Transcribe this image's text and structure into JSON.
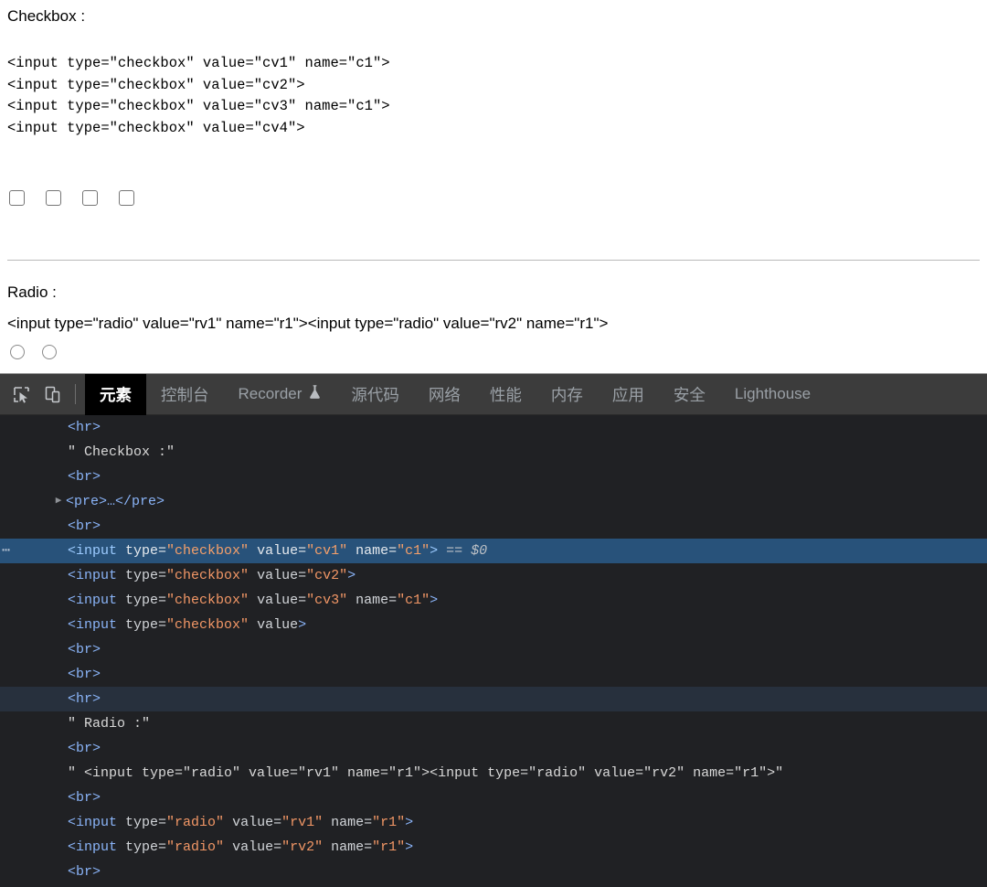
{
  "page": {
    "checkbox_heading": "Checkbox :",
    "checkbox_code": "<input type=\"checkbox\" value=\"cv1\" name=\"c1\">\n<input type=\"checkbox\" value=\"cv2\">\n<input type=\"checkbox\" value=\"cv3\" name=\"c1\">\n<input type=\"checkbox\" value=\"cv4\">",
    "checkboxes": [
      {
        "name": "checkbox-cv1",
        "checked": false
      },
      {
        "name": "checkbox-cv2",
        "checked": false
      },
      {
        "name": "checkbox-cv3",
        "checked": false
      },
      {
        "name": "checkbox-cv4",
        "checked": false
      }
    ],
    "radio_heading": "Radio :",
    "radio_code": "<input type=\"radio\" value=\"rv1\" name=\"r1\"><input type=\"radio\" value=\"rv2\" name=\"r1\">",
    "radios": [
      {
        "name": "radio-rv1",
        "checked": false
      },
      {
        "name": "radio-rv2",
        "checked": false
      }
    ]
  },
  "devtools": {
    "toolbar": {
      "inspect_icon": "inspect-element-cursor-icon",
      "device_icon": "device-toolbar-icon",
      "tabs": [
        {
          "label": "元素",
          "selected": true,
          "icon": null
        },
        {
          "label": "控制台",
          "selected": false,
          "icon": null
        },
        {
          "label": "Recorder",
          "selected": false,
          "icon": "flask-experimental-icon"
        },
        {
          "label": "源代码",
          "selected": false,
          "icon": null
        },
        {
          "label": "网络",
          "selected": false,
          "icon": null
        },
        {
          "label": "性能",
          "selected": false,
          "icon": null
        },
        {
          "label": "内存",
          "selected": false,
          "icon": null
        },
        {
          "label": "应用",
          "selected": false,
          "icon": null
        },
        {
          "label": "安全",
          "selected": false,
          "icon": null
        },
        {
          "label": "Lighthouse",
          "selected": false,
          "icon": null
        }
      ]
    },
    "colors": {
      "panel_background": "#202124",
      "toolbar_background": "#3c3c3c",
      "selected_row": "#28527a",
      "hovered_row": "#27303d",
      "tag_color": "#8ab4f8",
      "attr_value_color": "#f29766",
      "attr_name_color": "#d2d5d9",
      "tab_inactive_color": "#9aa0a6",
      "selected_tab_background": "#000000"
    },
    "dom_rows": [
      {
        "kind": "tag",
        "text": "<hr>",
        "state": "normal",
        "twisty": false,
        "ellipsis": false
      },
      {
        "kind": "text",
        "text": "\" Checkbox :\"",
        "state": "normal",
        "twisty": false,
        "ellipsis": false
      },
      {
        "kind": "tag",
        "text": "<br>",
        "state": "normal",
        "twisty": false,
        "ellipsis": false
      },
      {
        "kind": "collapsed",
        "text": "<pre>…</pre>",
        "state": "normal",
        "twisty": true,
        "ellipsis": false
      },
      {
        "kind": "tag",
        "text": "<br>",
        "state": "normal",
        "twisty": false,
        "ellipsis": false
      },
      {
        "kind": "element",
        "tag": "input",
        "attrs": [
          [
            "type",
            "checkbox"
          ],
          [
            "value",
            "cv1"
          ],
          [
            "name",
            "c1"
          ]
        ],
        "badge": "== $0",
        "state": "selected",
        "twisty": false,
        "ellipsis": true
      },
      {
        "kind": "element",
        "tag": "input",
        "attrs": [
          [
            "type",
            "checkbox"
          ],
          [
            "value",
            "cv2"
          ]
        ],
        "badge": "",
        "state": "normal",
        "twisty": false,
        "ellipsis": false
      },
      {
        "kind": "element",
        "tag": "input",
        "attrs": [
          [
            "type",
            "checkbox"
          ],
          [
            "value",
            "cv3"
          ],
          [
            "name",
            "c1"
          ]
        ],
        "badge": "",
        "state": "normal",
        "twisty": false,
        "ellipsis": false
      },
      {
        "kind": "element",
        "tag": "input",
        "attrs": [
          [
            "type",
            "checkbox"
          ],
          [
            "value",
            null
          ]
        ],
        "badge": "",
        "state": "normal",
        "twisty": false,
        "ellipsis": false
      },
      {
        "kind": "tag",
        "text": "<br>",
        "state": "normal",
        "twisty": false,
        "ellipsis": false
      },
      {
        "kind": "tag",
        "text": "<br>",
        "state": "normal",
        "twisty": false,
        "ellipsis": false
      },
      {
        "kind": "tag",
        "text": "<hr>",
        "state": "hovered",
        "twisty": false,
        "ellipsis": false
      },
      {
        "kind": "text",
        "text": "\" Radio :\"",
        "state": "normal",
        "twisty": false,
        "ellipsis": false
      },
      {
        "kind": "tag",
        "text": "<br>",
        "state": "normal",
        "twisty": false,
        "ellipsis": false
      },
      {
        "kind": "text",
        "text": "\" <input type=\"radio\" value=\"rv1\" name=\"r1\"><input type=\"radio\" value=\"rv2\" name=\"r1\">\"",
        "state": "normal",
        "twisty": false,
        "ellipsis": false
      },
      {
        "kind": "tag",
        "text": "<br>",
        "state": "normal",
        "twisty": false,
        "ellipsis": false
      },
      {
        "kind": "element",
        "tag": "input",
        "attrs": [
          [
            "type",
            "radio"
          ],
          [
            "value",
            "rv1"
          ],
          [
            "name",
            "r1"
          ]
        ],
        "badge": "",
        "state": "normal",
        "twisty": false,
        "ellipsis": false
      },
      {
        "kind": "element",
        "tag": "input",
        "attrs": [
          [
            "type",
            "radio"
          ],
          [
            "value",
            "rv2"
          ],
          [
            "name",
            "r1"
          ]
        ],
        "badge": "",
        "state": "normal",
        "twisty": false,
        "ellipsis": false
      },
      {
        "kind": "tag",
        "text": "<br>",
        "state": "normal",
        "twisty": false,
        "ellipsis": false
      }
    ]
  }
}
